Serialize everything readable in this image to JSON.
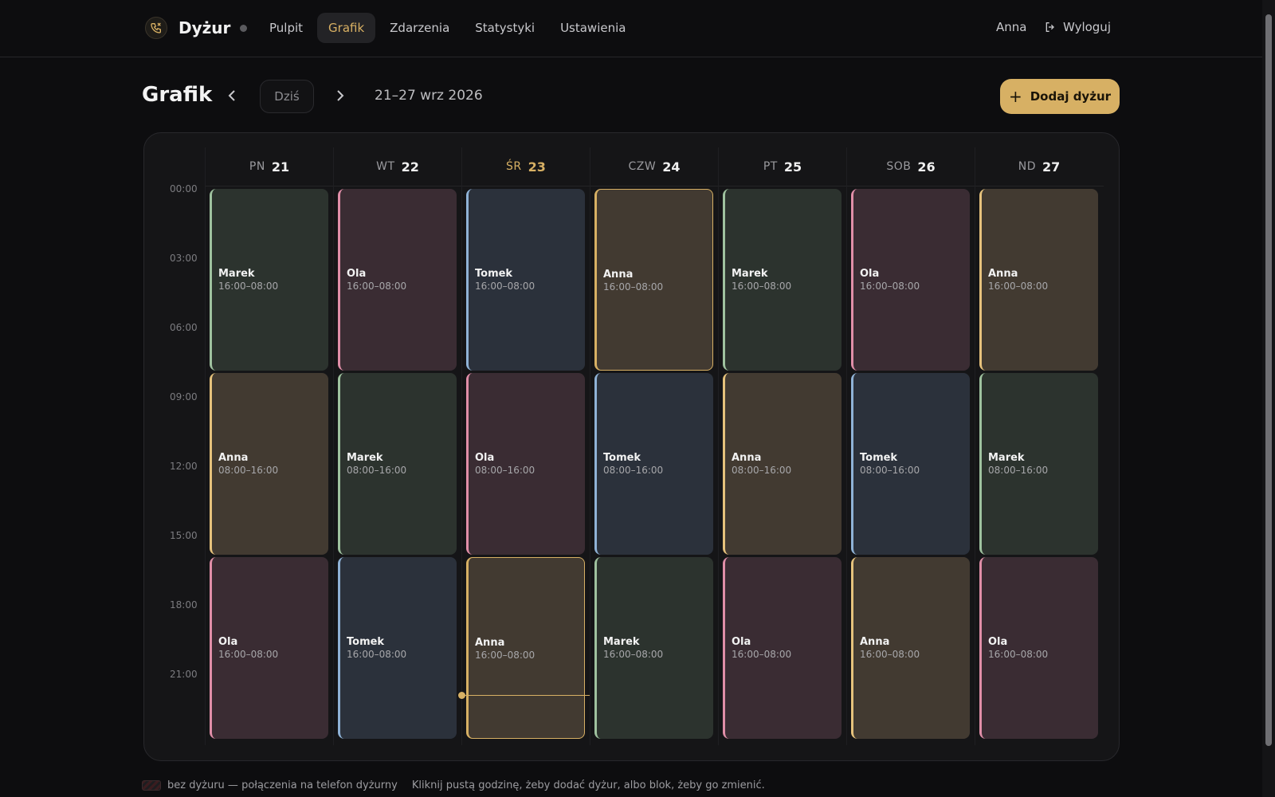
{
  "app": {
    "name": "Dyżur",
    "logo_icon": "phone-icon"
  },
  "nav": [
    {
      "label": "Pulpit",
      "active": false
    },
    {
      "label": "Grafik",
      "active": true
    },
    {
      "label": "Zdarzenia",
      "active": false
    },
    {
      "label": "Statystyki",
      "active": false
    },
    {
      "label": "Ustawienia",
      "active": false
    }
  ],
  "user": {
    "name": "Anna",
    "logout_label": "Wyloguj"
  },
  "header": {
    "title": "Grafik",
    "today_label": "Dziś",
    "range": "21–27 wrz 2026",
    "add_label": "Dodaj dyżur"
  },
  "days": [
    {
      "name": "PN",
      "num": "21",
      "today": false
    },
    {
      "name": "WT",
      "num": "22",
      "today": false
    },
    {
      "name": "ŚR",
      "num": "23",
      "today": true
    },
    {
      "name": "CZW",
      "num": "24",
      "today": false
    },
    {
      "name": "PT",
      "num": "25",
      "today": false
    },
    {
      "name": "SOB",
      "num": "26",
      "today": false
    },
    {
      "name": "ND",
      "num": "27",
      "today": false
    }
  ],
  "hours": [
    "00:00",
    "03:00",
    "06:00",
    "09:00",
    "12:00",
    "15:00",
    "18:00",
    "21:00"
  ],
  "people_colors": {
    "Marek": {
      "bg": "#2c332e",
      "accent": "#9fc29f"
    },
    "Ola": {
      "bg": "#3a2c33",
      "accent": "#e08ea8"
    },
    "Tomek": {
      "bg": "#2b313b",
      "accent": "#8fb2d6"
    },
    "Anna": {
      "bg": "#423a31",
      "accent": "#e6c27c"
    }
  },
  "shifts": [
    {
      "day": 0,
      "slot": 0,
      "person": "Marek",
      "time": "16:00–08:00"
    },
    {
      "day": 0,
      "slot": 1,
      "person": "Anna",
      "time": "08:00–16:00"
    },
    {
      "day": 0,
      "slot": 2,
      "person": "Ola",
      "time": "16:00–08:00"
    },
    {
      "day": 1,
      "slot": 0,
      "person": "Ola",
      "time": "16:00–08:00"
    },
    {
      "day": 1,
      "slot": 1,
      "person": "Marek",
      "time": "08:00–16:00"
    },
    {
      "day": 1,
      "slot": 2,
      "person": "Tomek",
      "time": "16:00–08:00"
    },
    {
      "day": 2,
      "slot": 0,
      "person": "Tomek",
      "time": "16:00–08:00"
    },
    {
      "day": 2,
      "slot": 1,
      "person": "Ola",
      "time": "08:00–16:00"
    },
    {
      "day": 2,
      "slot": 2,
      "person": "Anna",
      "time": "16:00–08:00",
      "selected": true
    },
    {
      "day": 3,
      "slot": 0,
      "person": "Anna",
      "time": "16:00–08:00",
      "selected": true
    },
    {
      "day": 3,
      "slot": 1,
      "person": "Tomek",
      "time": "08:00–16:00"
    },
    {
      "day": 3,
      "slot": 2,
      "person": "Marek",
      "time": "16:00–08:00"
    },
    {
      "day": 4,
      "slot": 0,
      "person": "Marek",
      "time": "16:00–08:00"
    },
    {
      "day": 4,
      "slot": 1,
      "person": "Anna",
      "time": "08:00–16:00"
    },
    {
      "day": 4,
      "slot": 2,
      "person": "Ola",
      "time": "16:00–08:00"
    },
    {
      "day": 5,
      "slot": 0,
      "person": "Ola",
      "time": "16:00–08:00"
    },
    {
      "day": 5,
      "slot": 1,
      "person": "Tomek",
      "time": "08:00–16:00"
    },
    {
      "day": 5,
      "slot": 2,
      "person": "Anna",
      "time": "16:00–08:00"
    },
    {
      "day": 6,
      "slot": 0,
      "person": "Anna",
      "time": "16:00–08:00"
    },
    {
      "day": 6,
      "slot": 1,
      "person": "Marek",
      "time": "08:00–16:00"
    },
    {
      "day": 6,
      "slot": 2,
      "person": "Ola",
      "time": "16:00–08:00"
    }
  ],
  "now_marker": {
    "day": 2,
    "time": "22:00"
  },
  "footer": {
    "legend_label": "bez dyżuru — połączenia na telefon dyżurny",
    "hint": "Kliknij pustą godzinę, żeby dodać dyżur, albo blok, żeby go zmienić."
  },
  "colors": {
    "accent": "#d7b064",
    "background": "#0d0d0f"
  }
}
